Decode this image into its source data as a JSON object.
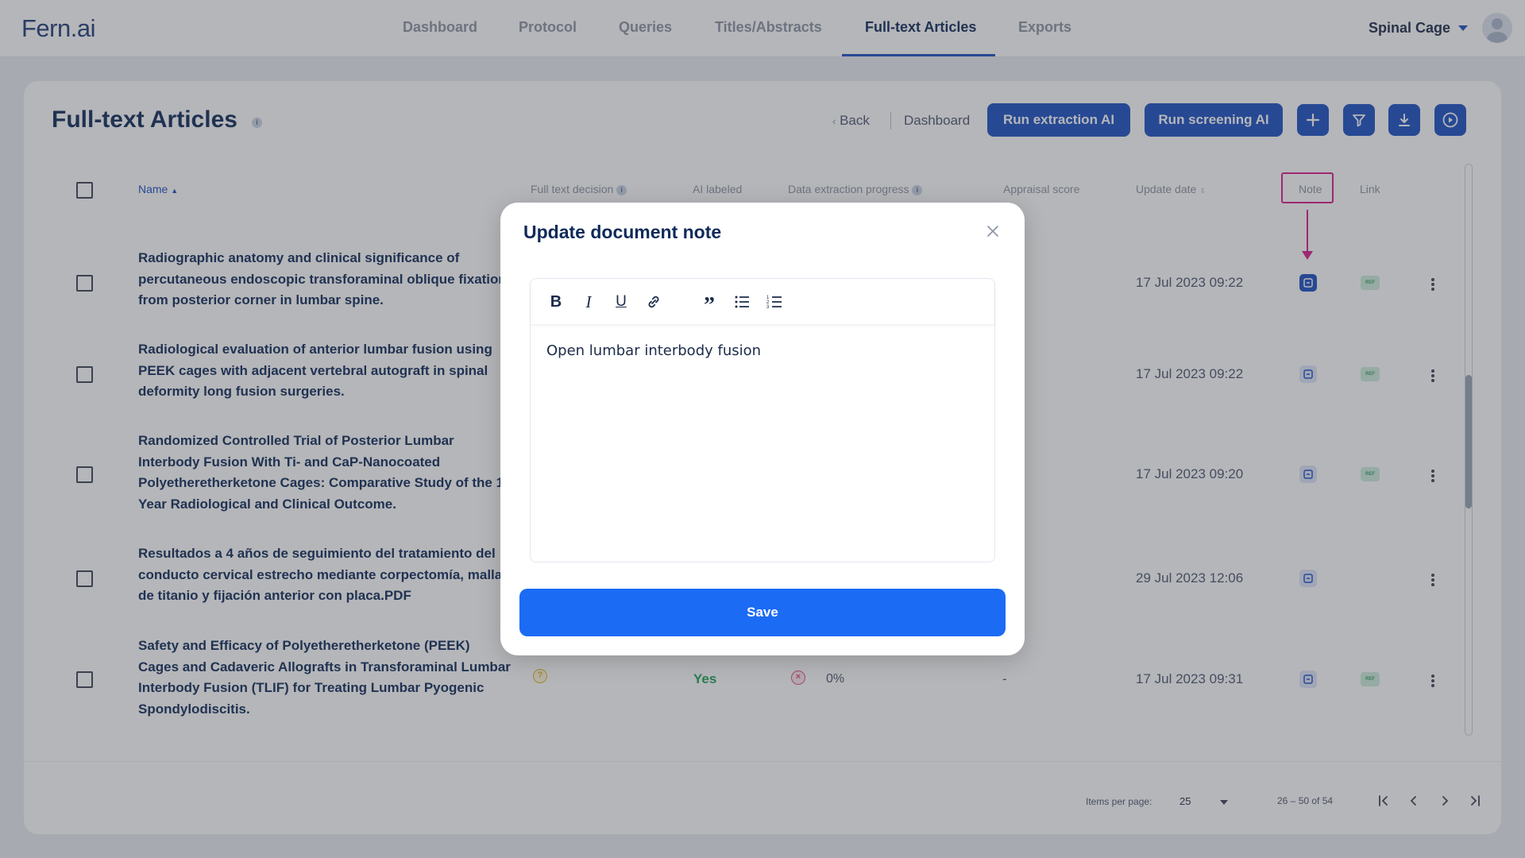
{
  "app": {
    "logo_text": "Fern.ai"
  },
  "nav": {
    "tabs": [
      {
        "label": "Dashboard"
      },
      {
        "label": "Protocol"
      },
      {
        "label": "Queries"
      },
      {
        "label": "Titles/Abstracts"
      },
      {
        "label": "Full-text Articles"
      },
      {
        "label": "Exports"
      }
    ],
    "active_tab": "Full-text Articles",
    "project": "Spinal Cage"
  },
  "page": {
    "title": "Full-text Articles",
    "back_label": "Back",
    "dashboard_label": "Dashboard",
    "run_extraction_label": "Run extraction AI",
    "run_screening_label": "Run screening AI",
    "icon_buttons": [
      "plus-icon",
      "filter-icon",
      "download-icon",
      "play-icon"
    ]
  },
  "table": {
    "columns": [
      "Name",
      "Full text decision",
      "AI labeled",
      "Data extraction progress",
      "Appraisal score",
      "Update date",
      "Note",
      "Link"
    ],
    "rows": [
      {
        "title": "Radiographic anatomy and clinical significance of percutaneous endoscopic transforaminal oblique fixation from posterior corner in lumbar spine.",
        "date": "17 Jul 2023 09:22",
        "has_ref": true
      },
      {
        "title": "Radiological evaluation of anterior lumbar fusion using PEEK cages with adjacent vertebral autograft in spinal deformity long fusion surgeries.",
        "date": "17 Jul 2023 09:22",
        "has_ref": true
      },
      {
        "title": "Randomized Controlled Trial of Posterior Lumbar Interbody Fusion With Ti- and CaP-Nanocoated Polyetheretherketone Cages: Comparative Study of the 1-Year Radiological and Clinical Outcome.",
        "date": "17 Jul 2023 09:20",
        "has_ref": true
      },
      {
        "title": "Resultados a 4 años de seguimiento del tratamiento del conducto cervical estrecho mediante corpectomía, malla de titanio y fijación anterior con placa.PDF",
        "date": "29 Jul 2023 12:06",
        "has_ref": false
      },
      {
        "title": "Safety and Efficacy of Polyetheretherketone (PEEK) Cages and Cadaveric Allografts in Transforaminal Lumbar Interbody Fusion (TLIF) for Treating Lumbar Pyogenic Spondylodiscitis.",
        "date": "17 Jul 2023 09:31",
        "has_ref": true,
        "ai_labeled": "Yes",
        "progress": "0%",
        "appraisal": "-"
      }
    ],
    "ref_badge": "REF"
  },
  "pagination": {
    "items_per_page_label": "Items per page:",
    "items_per_page": "25",
    "range": "26 – 50 of 54"
  },
  "modal": {
    "title": "Update document note",
    "note_text": "Open lumbar interbody fusion",
    "save_label": "Save",
    "toolbar": [
      "bold",
      "italic",
      "underline",
      "link",
      "blockquote",
      "bullet-list",
      "numbered-list"
    ]
  },
  "colors": {
    "primary": "#1b4fc4",
    "save": "#1b6bf5",
    "highlight": "#d81b8c",
    "yes": "#21a35a"
  }
}
